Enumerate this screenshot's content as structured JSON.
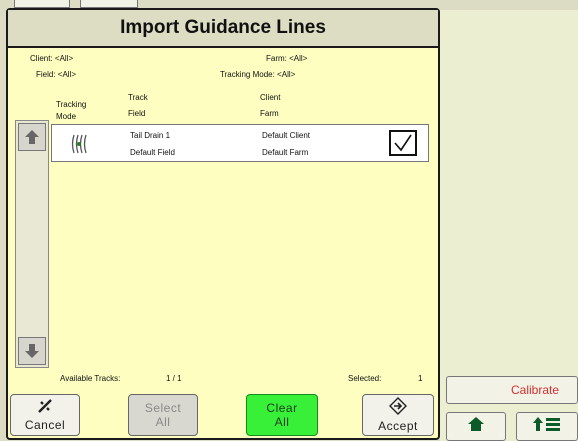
{
  "dialog": {
    "title": "Import Guidance Lines",
    "filters": {
      "client": "Client: <All>",
      "field": "Field: <All>",
      "farm": "Farm: <All>",
      "tracking_mode": "Tracking Mode: <All>"
    },
    "columns": {
      "tracking_mode": [
        "Tracking",
        "Mode"
      ],
      "track_field": [
        "Track",
        "Field"
      ],
      "client_farm": [
        "Client",
        "Farm"
      ]
    },
    "rows": [
      {
        "track": "Tail Drain 1",
        "field": "Default Field",
        "client": "Default Client",
        "farm": "Default Farm",
        "checked": true,
        "tracking_icon": "curve-track-icon"
      }
    ],
    "footer": {
      "available_label": "Available Tracks:",
      "available_value": "1 / 1",
      "selected_label": "Selected:",
      "selected_value": "1"
    },
    "buttons": {
      "cancel": "Cancel",
      "select_all": [
        "Select",
        "All"
      ],
      "clear_all": [
        "Clear",
        "All"
      ],
      "accept": "Accept"
    }
  },
  "side": {
    "calibrate": "Calibrate"
  },
  "colors": {
    "dialog_bg": "#fefec0",
    "clear_all_green": "#38f038",
    "calibrate_text": "#d03030"
  },
  "icons": {
    "cancel": "cancel-icon",
    "accept": "accept-icon",
    "scroll_up": "arrow-up-icon",
    "scroll_down": "arrow-down-icon",
    "home": "home-icon",
    "menu": "menu-icon"
  }
}
